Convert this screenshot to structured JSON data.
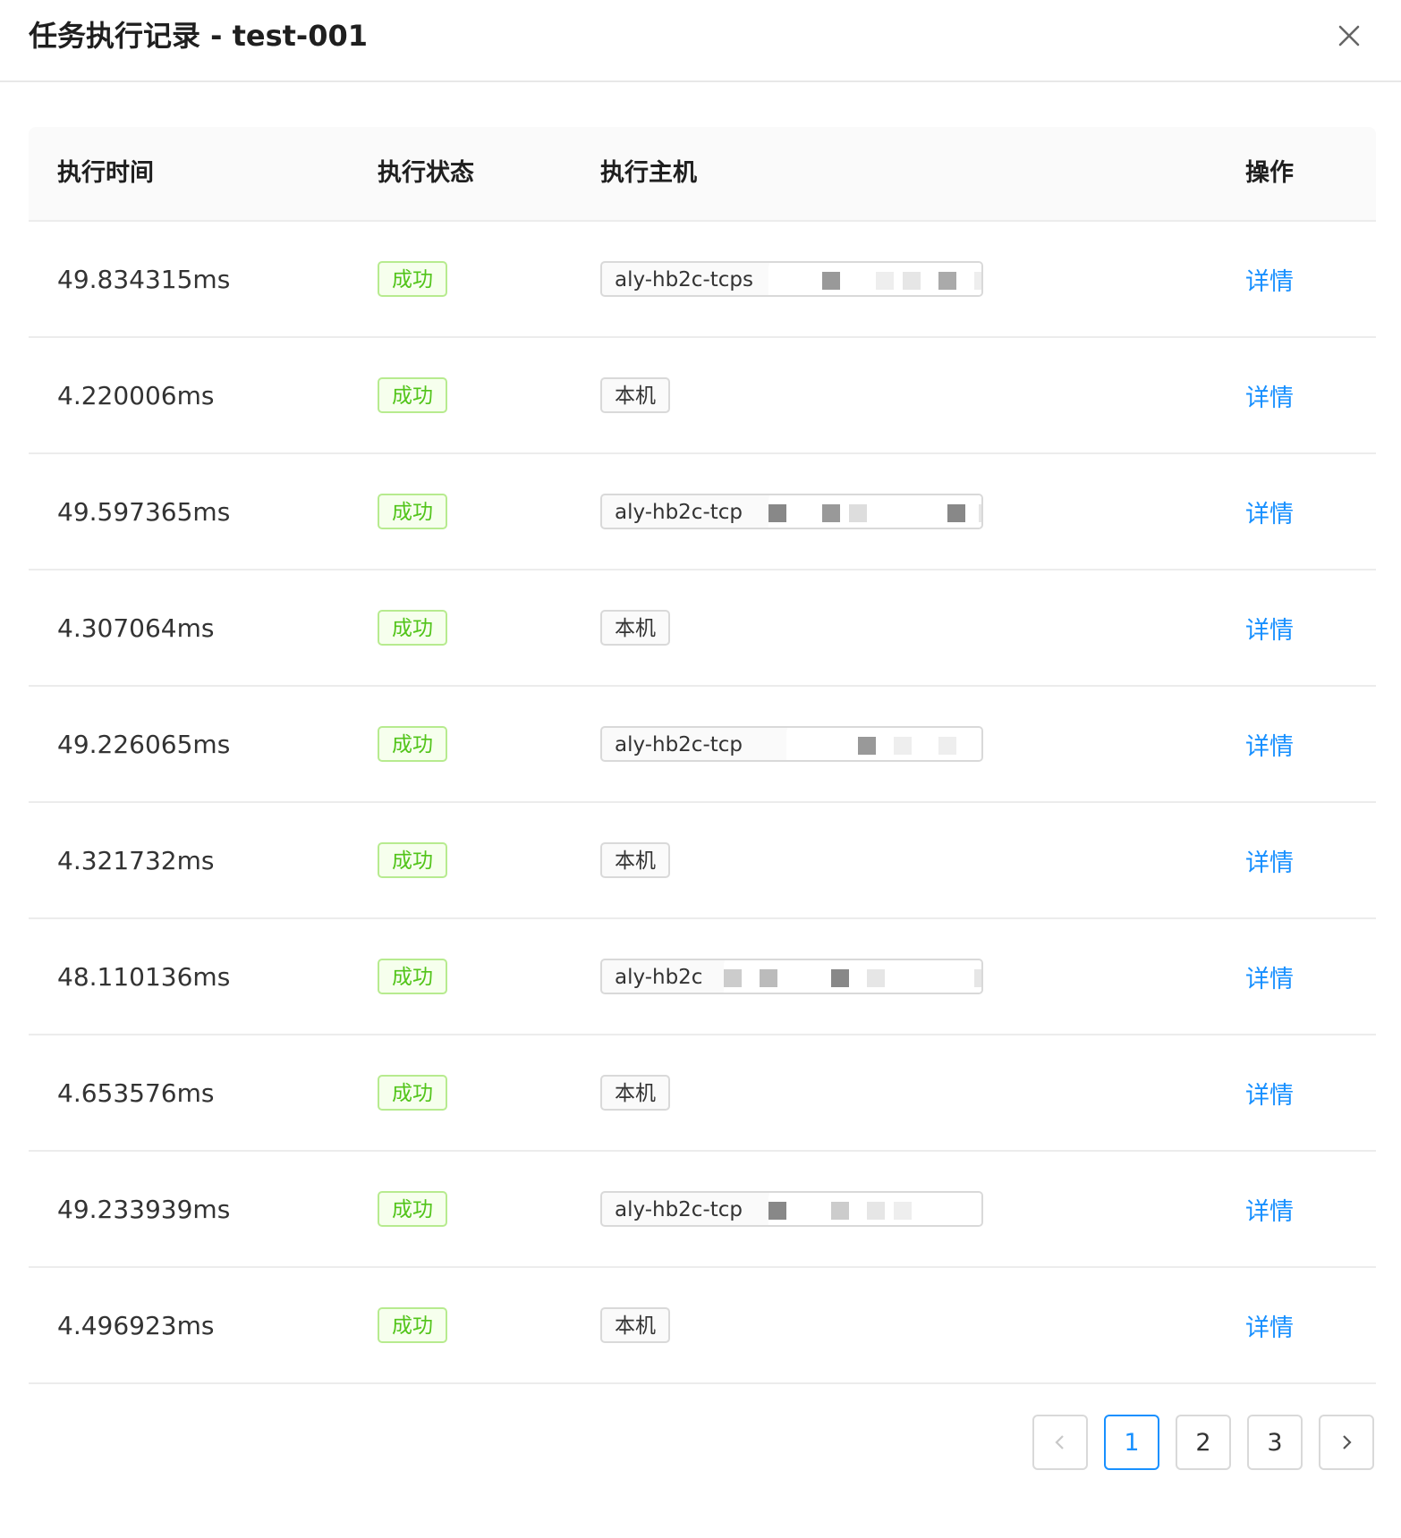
{
  "modal": {
    "title": "任务执行记录 - test-001",
    "close_icon": "close-icon"
  },
  "table": {
    "columns": [
      "执行时间",
      "执行状态",
      "执行主机",
      "操作"
    ],
    "rows": [
      {
        "time": "49.834315ms",
        "status": "成功",
        "host": "aly-hb2c-tcps",
        "action": "详情"
      },
      {
        "time": "4.220006ms",
        "status": "成功",
        "host": "本机",
        "action": "详情"
      },
      {
        "time": "49.597365ms",
        "status": "成功",
        "host": "aly-hb2c-tcp",
        "action": "详情"
      },
      {
        "time": "4.307064ms",
        "status": "成功",
        "host": "本机",
        "action": "详情"
      },
      {
        "time": "49.226065ms",
        "status": "成功",
        "host": "aly-hb2c-tcp",
        "action": "详情"
      },
      {
        "time": "4.321732ms",
        "status": "成功",
        "host": "本机",
        "action": "详情"
      },
      {
        "time": "48.110136ms",
        "status": "成功",
        "host": "aly-hb2c",
        "action": "详情"
      },
      {
        "time": "4.653576ms",
        "status": "成功",
        "host": "本机",
        "action": "详情"
      },
      {
        "time": "49.233939ms",
        "status": "成功",
        "host": "aly-hb2c-tcp",
        "action": "详情"
      },
      {
        "time": "4.496923ms",
        "status": "成功",
        "host": "本机",
        "action": "详情"
      }
    ]
  },
  "pagination": {
    "prev_icon": "chevron-left-icon",
    "next_icon": "chevron-right-icon",
    "pages": [
      "1",
      "2",
      "3"
    ],
    "current": "1"
  },
  "colors": {
    "link": "#1890ff",
    "success_text": "#52c41a",
    "success_border": "#b7eb8f",
    "success_bg": "#f6ffed"
  }
}
